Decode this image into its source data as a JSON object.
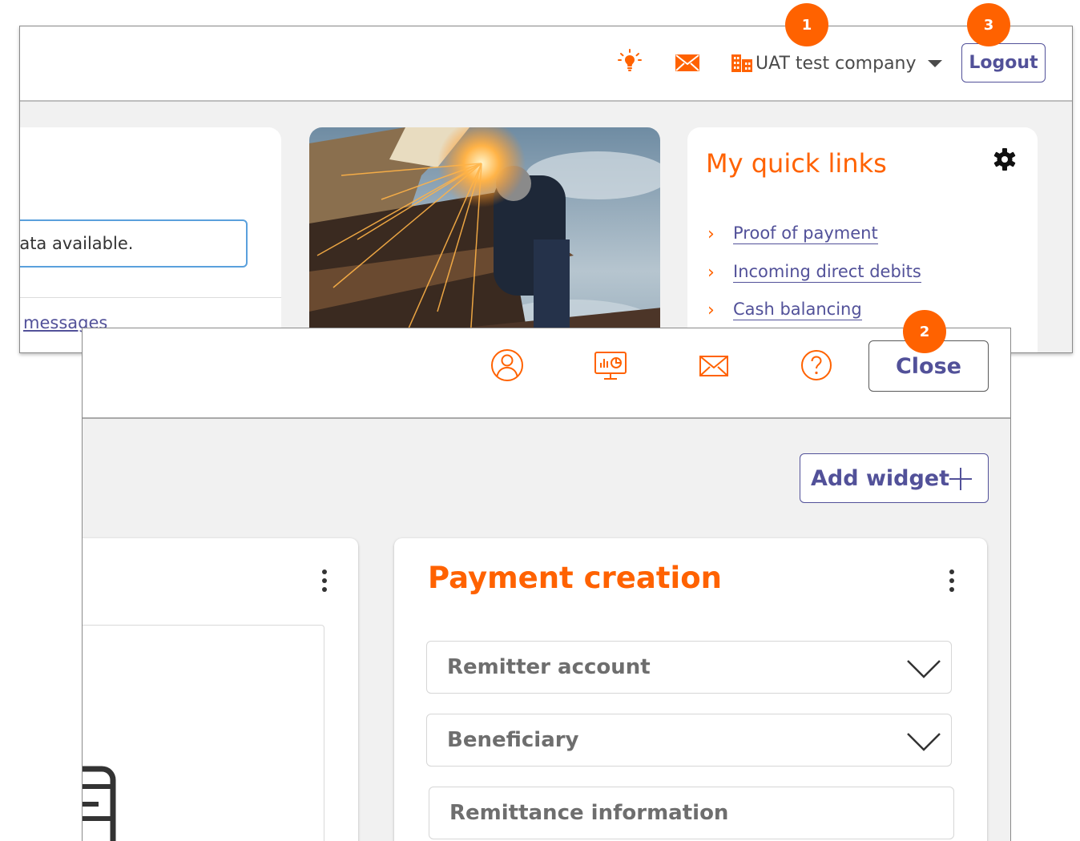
{
  "top_screen": {
    "header": {
      "company": "UAT test company",
      "logout_label": "Logout"
    },
    "left_card": {
      "message": "data available.",
      "link": "messages"
    },
    "quick_links": {
      "title": "My quick links",
      "items": [
        {
          "label": "Proof of payment"
        },
        {
          "label": "Incoming direct debits"
        },
        {
          "label": "Cash balancing"
        }
      ]
    }
  },
  "bottom_screen": {
    "header": {
      "close_label": "Close"
    },
    "add_widget_label": "Add widget",
    "payment_card": {
      "title": "Payment creation",
      "fields": [
        {
          "placeholder": "Remitter account"
        },
        {
          "placeholder": "Beneficiary"
        },
        {
          "placeholder": "Remittance information"
        }
      ]
    }
  },
  "callouts": [
    "1",
    "2",
    "3"
  ],
  "colors": {
    "accent": "#ff6200",
    "link": "#525199",
    "background": "#f1f1f1",
    "focus_border": "#5aa0dc"
  },
  "icons": [
    "lightbulb-icon",
    "mail-icon",
    "company-icon",
    "gear-icon",
    "chevron-right-icon",
    "profile-icon",
    "dashboard-icon",
    "help-icon",
    "plus-icon",
    "kebab-menu-icon",
    "chevron-down-icon",
    "document-icon"
  ]
}
